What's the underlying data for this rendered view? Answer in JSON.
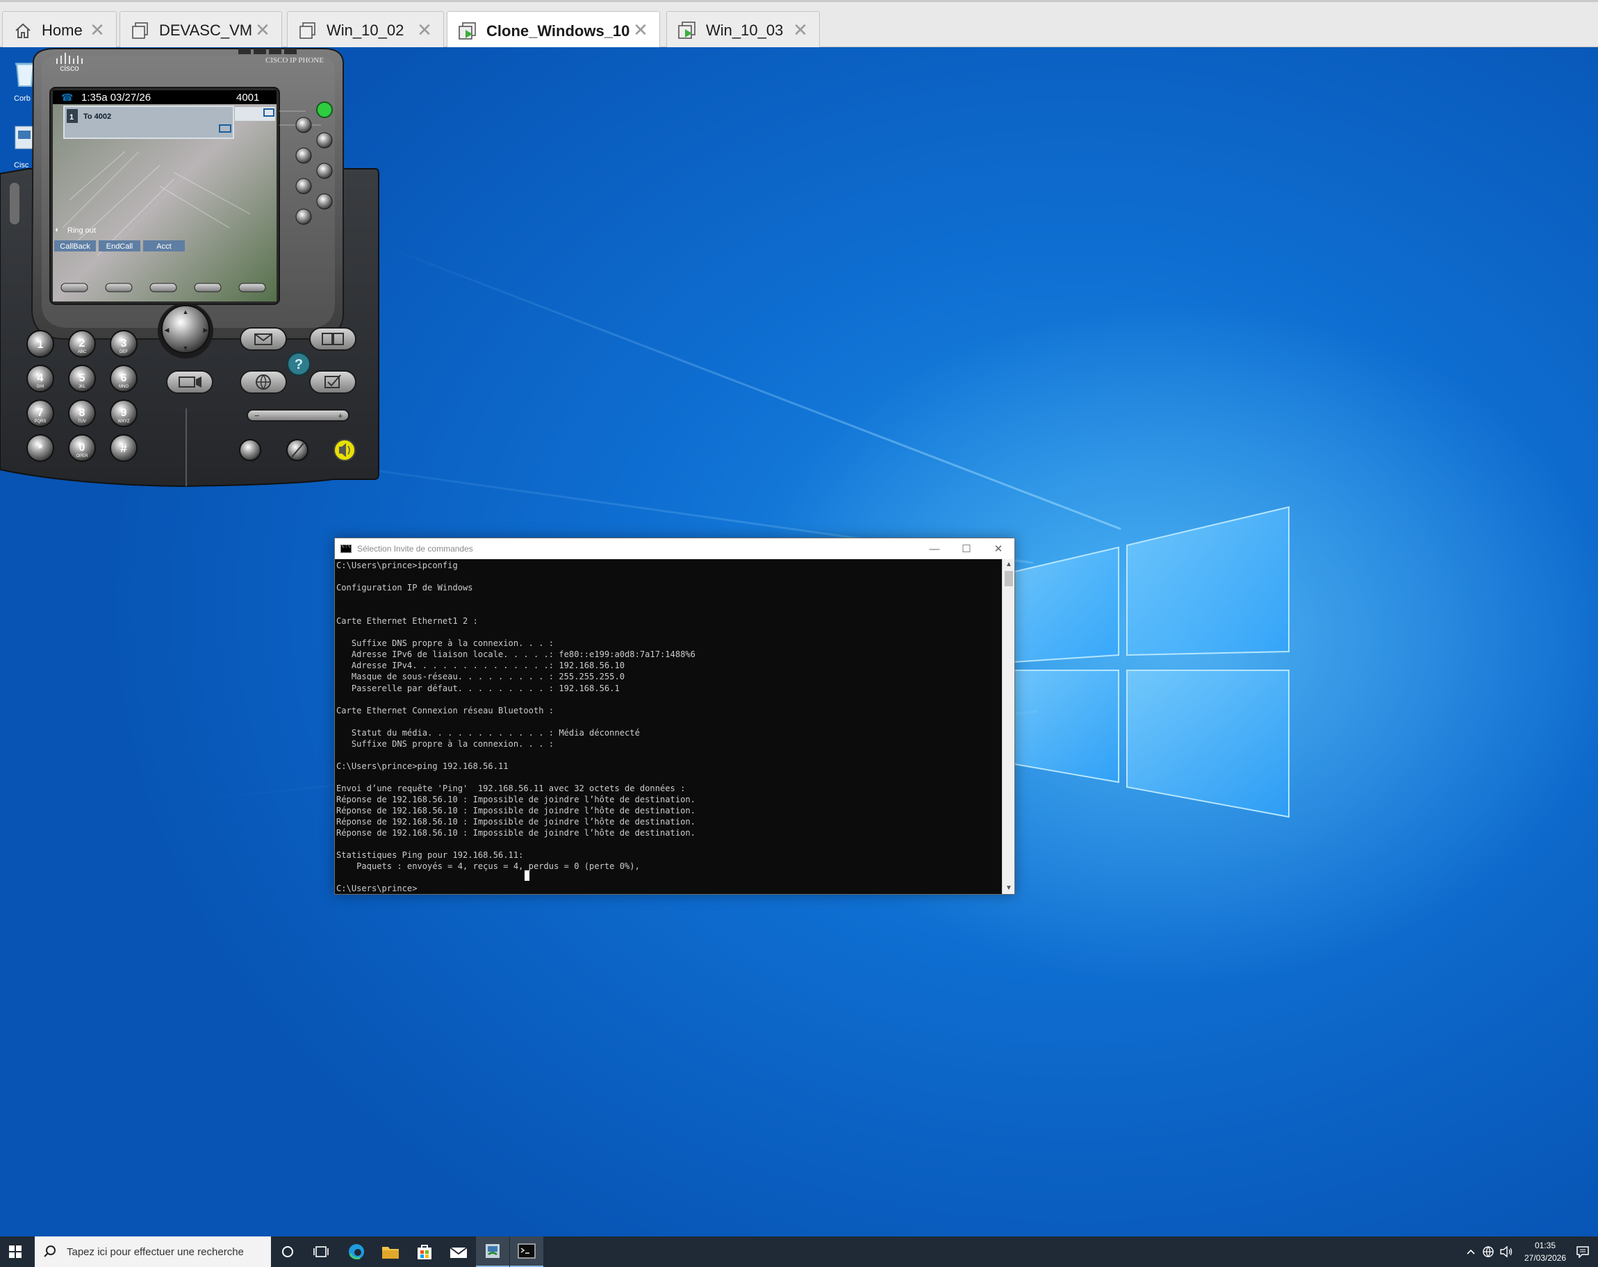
{
  "tabs": [
    {
      "label": "Home",
      "icon": "home-icon",
      "active": false
    },
    {
      "label": "DEVASC_VM",
      "icon": "vm-icon",
      "active": false
    },
    {
      "label": "Win_10_02",
      "icon": "vm-icon",
      "active": false
    },
    {
      "label": "Clone_Windows_10",
      "icon": "running-vm-icon",
      "active": true
    },
    {
      "label": "Win_10_03",
      "icon": "running-vm-icon",
      "active": false
    }
  ],
  "desktop_icons": [
    {
      "label": "Corb",
      "icon": "recycle-bin-icon"
    },
    {
      "label": "Cisc",
      "icon": "cisco-app-icon"
    }
  ],
  "phone": {
    "brand": "cisco",
    "model": "CISCO IP PHONE",
    "time": "1:35a 03/27/26",
    "ext": "4001",
    "line_num": "1",
    "call": "To 4002",
    "status": "Ring out",
    "softkeys": [
      "CallBack",
      "EndCall",
      "Acct"
    ],
    "keypad": [
      {
        "digit": "1",
        "sub": ""
      },
      {
        "digit": "2",
        "sub": "ABC"
      },
      {
        "digit": "3",
        "sub": "DEF"
      },
      {
        "digit": "4",
        "sub": "GHI"
      },
      {
        "digit": "5",
        "sub": "JKL"
      },
      {
        "digit": "6",
        "sub": "MNO"
      },
      {
        "digit": "7",
        "sub": "PQRS"
      },
      {
        "digit": "8",
        "sub": "TUV"
      },
      {
        "digit": "9",
        "sub": "WXYZ"
      },
      {
        "digit": "*",
        "sub": ""
      },
      {
        "digit": "0",
        "sub": "OPER"
      },
      {
        "digit": "#",
        "sub": ""
      }
    ],
    "help_glyph": "?"
  },
  "cmd": {
    "title": "Sélection Invite de commandes",
    "lines": [
      "C:\\Users\\prince>ipconfig",
      "",
      "Configuration IP de Windows",
      "",
      "",
      "Carte Ethernet Ethernet1 2 :",
      "",
      "   Suffixe DNS propre à la connexion. . . :",
      "   Adresse IPv6 de liaison locale. . . . .: fe80::e199:a0d8:7a17:1488%6",
      "   Adresse IPv4. . . . . . . . . . . . . .: 192.168.56.10",
      "   Masque de sous-réseau. . . . . . . . . : 255.255.255.0",
      "   Passerelle par défaut. . . . . . . . . : 192.168.56.1",
      "",
      "Carte Ethernet Connexion réseau Bluetooth :",
      "",
      "   Statut du média. . . . . . . . . . . . : Média déconnecté",
      "   Suffixe DNS propre à la connexion. . . :",
      "",
      "C:\\Users\\prince>ping 192.168.56.11",
      "",
      "Envoi d’une requête 'Ping'  192.168.56.11 avec 32 octets de données :",
      "Réponse de 192.168.56.10 : Impossible de joindre l’hôte de destination.",
      "Réponse de 192.168.56.10 : Impossible de joindre l’hôte de destination.",
      "Réponse de 192.168.56.10 : Impossible de joindre l’hôte de destination.",
      "Réponse de 192.168.56.10 : Impossible de joindre l’hôte de destination.",
      "",
      "Statistiques Ping pour 192.168.56.11:",
      "    Paquets : envoyés = 4, reçus = 4, perdus = 0 (perte 0%),",
      "",
      "C:\\Users\\prince>"
    ]
  },
  "taskbar": {
    "search_placeholder": "Tapez ici pour effectuer une recherche",
    "apps": [
      "cortana-icon",
      "task-view-icon",
      "edge-icon",
      "file-explorer-icon",
      "store-icon",
      "mail-icon",
      "ip-phone-app-icon",
      "cmd-icon"
    ],
    "time": "01:35",
    "date": "27/03/2026"
  },
  "colors": {
    "desktop_blue": "#0f6fd2",
    "taskbar": "#1f2a36",
    "cmd_bg": "#0c0c0c",
    "phone_green_led": "#2ecc40",
    "speaker_yellow": "#e8e000"
  }
}
